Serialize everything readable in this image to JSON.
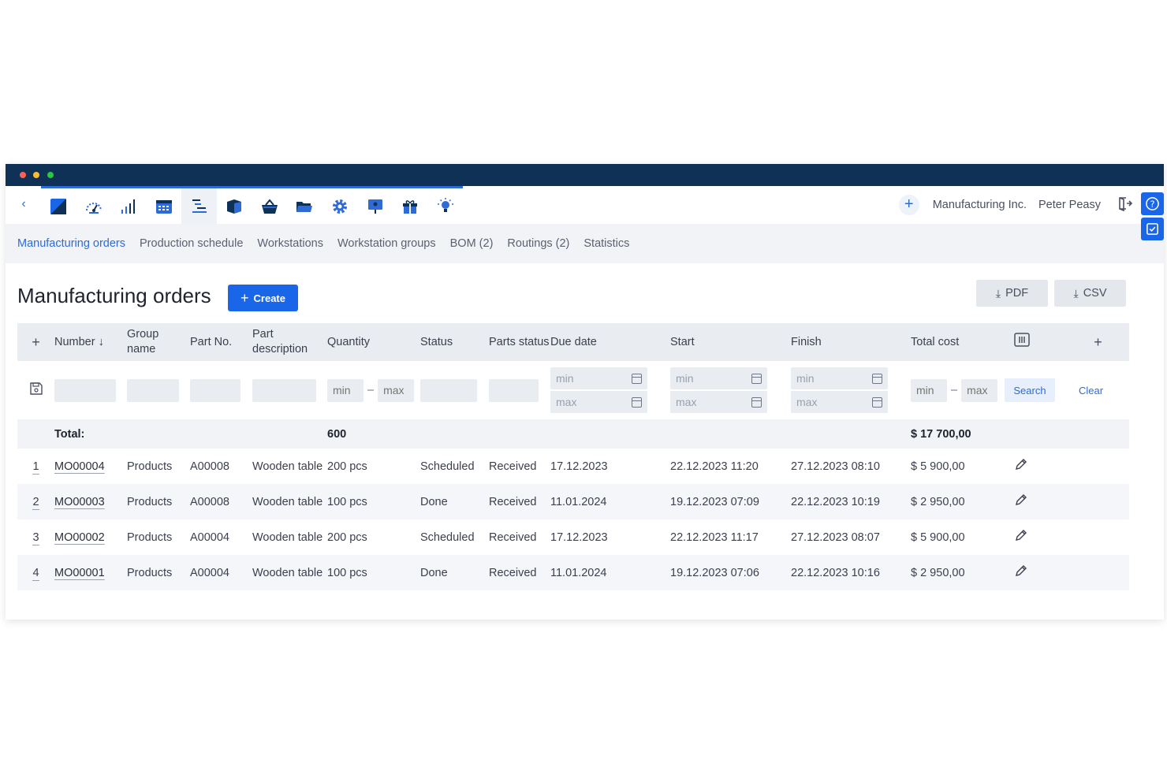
{
  "app": {
    "company": "Manufacturing Inc.",
    "user": "Peter Peasy",
    "app_icons": [
      "logo-icon",
      "dashboard-icon",
      "stats-bars-icon",
      "calendar-icon",
      "production-list-icon",
      "box-icon",
      "basket-icon",
      "folder-icon",
      "settings-gear-icon",
      "presentation-icon",
      "gift-icon",
      "lightbulb-icon"
    ]
  },
  "subnav": [
    {
      "label": "Manufacturing orders",
      "active": true
    },
    {
      "label": "Production schedule",
      "active": false
    },
    {
      "label": "Workstations",
      "active": false
    },
    {
      "label": "Workstation groups",
      "active": false
    },
    {
      "label": "BOM (2)",
      "active": false
    },
    {
      "label": "Routings (2)",
      "active": false
    },
    {
      "label": "Statistics",
      "active": false
    }
  ],
  "page": {
    "title": "Manufacturing orders",
    "create_label": "Create",
    "pdf_label": "PDF",
    "csv_label": "CSV"
  },
  "table": {
    "columns": {
      "number": "Number ↓",
      "group_name": "Group name",
      "part_no": "Part No.",
      "part_description": "Part description",
      "quantity": "Quantity",
      "status": "Status",
      "parts_status": "Parts status",
      "due_date": "Due date",
      "start": "Start",
      "finish": "Finish",
      "total_cost": "Total cost"
    },
    "filters": {
      "min": "min",
      "max": "max",
      "search_label": "Search",
      "clear_label": "Clear"
    },
    "total": {
      "label": "Total:",
      "quantity": "600",
      "total_cost": "$ 17 700,00"
    },
    "rows": [
      {
        "idx": "1",
        "number": "MO00004",
        "group": "Products",
        "part_no": "A00008",
        "desc": "Wooden table",
        "qty": "200 pcs",
        "status": "Scheduled",
        "parts_status": "Received",
        "due": "17.12.2023",
        "start": "22.12.2023 11:20",
        "finish": "27.12.2023 08:10",
        "cost": "$ 5 900,00"
      },
      {
        "idx": "2",
        "number": "MO00003",
        "group": "Products",
        "part_no": "A00008",
        "desc": "Wooden table",
        "qty": "100 pcs",
        "status": "Done",
        "parts_status": "Received",
        "due": "11.01.2024",
        "start": "19.12.2023 07:09",
        "finish": "22.12.2023 10:19",
        "cost": "$ 2 950,00"
      },
      {
        "idx": "3",
        "number": "MO00002",
        "group": "Products",
        "part_no": "A00004",
        "desc": "Wooden table",
        "qty": "200 pcs",
        "status": "Scheduled",
        "parts_status": "Received",
        "due": "17.12.2023",
        "start": "22.12.2023 11:17",
        "finish": "27.12.2023 08:07",
        "cost": "$ 5 900,00"
      },
      {
        "idx": "4",
        "number": "MO00001",
        "group": "Products",
        "part_no": "A00004",
        "desc": "Wooden table",
        "qty": "100 pcs",
        "status": "Done",
        "parts_status": "Received",
        "due": "11.01.2024",
        "start": "19.12.2023 07:06",
        "finish": "22.12.2023 10:16",
        "cost": "$ 2 950,00"
      }
    ]
  },
  "colors": {
    "accent": "#1a66e8",
    "titlebar": "#0f3155",
    "header_bg": "#e9ecf1"
  }
}
